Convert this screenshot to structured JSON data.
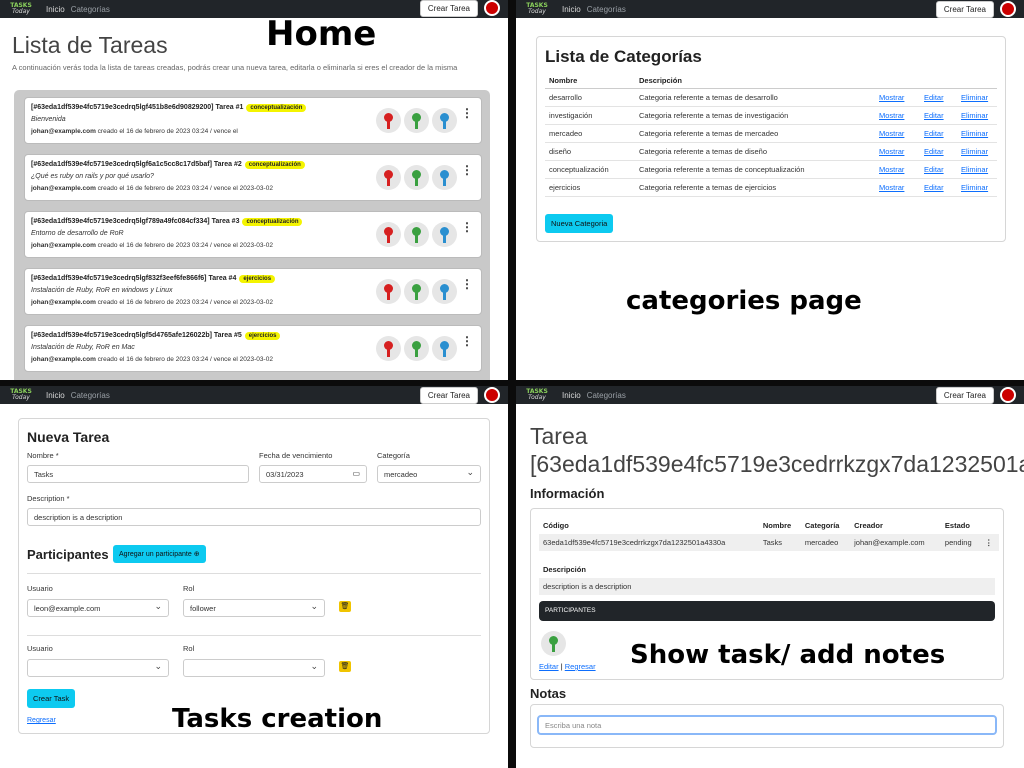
{
  "nav": {
    "logo_top": "TASKS",
    "logo_bottom": "Today",
    "inicio": "Inicio",
    "categorias": "Categorías",
    "crear_tarea": "Crear Tarea"
  },
  "captions": {
    "home": "Home",
    "categories": "categories page",
    "tasks_creation": "Tasks creation",
    "show_task": "Show task/ add notes"
  },
  "home": {
    "title": "Lista de Tareas",
    "description": "A continuación verás toda la lista de tareas creadas, podrás crear una nueva tarea, editarla o eliminarla si eres el creador de la misma",
    "tasks": [
      {
        "id": "[#63eda1df539e4fc5719e3cedrq5lgf451b8e6d90829200]",
        "name": "Tarea #1",
        "badge": "conceptualización",
        "desc": "Bienvenida",
        "email": "johan@example.com",
        "meta": " creado el 16 de febrero de 2023 03:24 / vence el"
      },
      {
        "id": "[#63eda1df539e4fc5719e3cedrq5lgf6a1c5cc8c17d5baf]",
        "name": "Tarea #2",
        "badge": "conceptualización",
        "desc": "¿Qué es ruby on rails y por qué usarlo?",
        "email": "johan@example.com",
        "meta": " creado el 16 de febrero de 2023 03:24 / vence el 2023-03-02"
      },
      {
        "id": "[#63eda1df539e4fc5719e3cedrq5lgf789a49fc084cf334]",
        "name": "Tarea #3",
        "badge": "conceptualización",
        "desc": "Entorno de desarrollo de RoR",
        "email": "johan@example.com",
        "meta": " creado el 16 de febrero de 2023 03:24 / vence el 2023-03-02"
      },
      {
        "id": "[#63eda1df539e4fc5719e3cedrq5lgf832f3eef6fe866f6]",
        "name": "Tarea #4",
        "badge": "ejercicios",
        "desc": "Instalación de Ruby, RoR en windows y Linux",
        "email": "johan@example.com",
        "meta": " creado el 16 de febrero de 2023 03:24 / vence el 2023-03-02"
      },
      {
        "id": "[#63eda1df539e4fc5719e3cedrq5lgf5d4765afe126022b]",
        "name": "Tarea #5",
        "badge": "ejercicios",
        "desc": "Instalación de Ruby, RoR en Mac",
        "email": "johan@example.com",
        "meta": " creado el 16 de febrero de 2023 03:24 / vence el 2023-03-02"
      }
    ]
  },
  "categories": {
    "title": "Lista de Categorías",
    "headers": [
      "Nombre",
      "Descripción"
    ],
    "rows": [
      {
        "name": "desarrollo",
        "desc": "Categoria referente a temas de desarrollo"
      },
      {
        "name": "investigación",
        "desc": "Categoria referente a temas de investigación"
      },
      {
        "name": "mercadeo",
        "desc": "Categoria referente a temas de mercadeo"
      },
      {
        "name": "diseño",
        "desc": "Categoria referente a temas de diseño"
      },
      {
        "name": "conceptualización",
        "desc": "Categoria referente a temas de conceptualización"
      },
      {
        "name": "ejercicios",
        "desc": "Categoria referente a temas de ejercicios"
      }
    ],
    "actions": {
      "show": "Mostrar",
      "edit": "Editar",
      "delete": "Eliminar"
    },
    "new_button": "Nueva Categoria"
  },
  "new_task": {
    "title": "Nueva Tarea",
    "name_label": "Nombre *",
    "name_value": "Tasks",
    "date_label": "Fecha de vencimiento",
    "date_value": "03/31/2023",
    "category_label": "Categoría",
    "category_value": "mercadeo",
    "description_label": "Description *",
    "description_value": "description is a description",
    "participants_title": "Participantes",
    "add_participant": "Agregar un participante",
    "user_label": "Usuario",
    "role_label": "Rol",
    "participant1_user": "leon@example.com",
    "participant1_role": "follower",
    "create_button": "Crear Task",
    "back_link": "Regresar"
  },
  "show_task": {
    "title_line1": "Tarea",
    "title_line2": "[63eda1df539e4fc5719e3cedrrkzgx7da1232501a",
    "info_title": "Información",
    "headers": [
      "Código",
      "Nombre",
      "Categoría",
      "Creador",
      "Estado"
    ],
    "row": [
      "63eda1df539e4fc5719e3cedrrkzgx7da1232501a4330a",
      "Tasks",
      "mercadeo",
      "johan@example.com",
      "pending"
    ],
    "desc_label": "Descripción",
    "desc_value": "description is a description",
    "participants_bar": "PARTICIPANTES",
    "edit_link": "Editar",
    "separator": "|",
    "back_link": "Regresar",
    "notes_title": "Notas",
    "note_placeholder": "Escriba una nota"
  },
  "colors": {
    "navbar": "#212529",
    "badge": "#f4f400",
    "info_button": "#0dcaf0",
    "link": "#0d6efd",
    "trash": "#f0c400",
    "robot_red": "#d62020",
    "robot_green": "#3aa040",
    "robot_blue": "#2a8fd0"
  }
}
